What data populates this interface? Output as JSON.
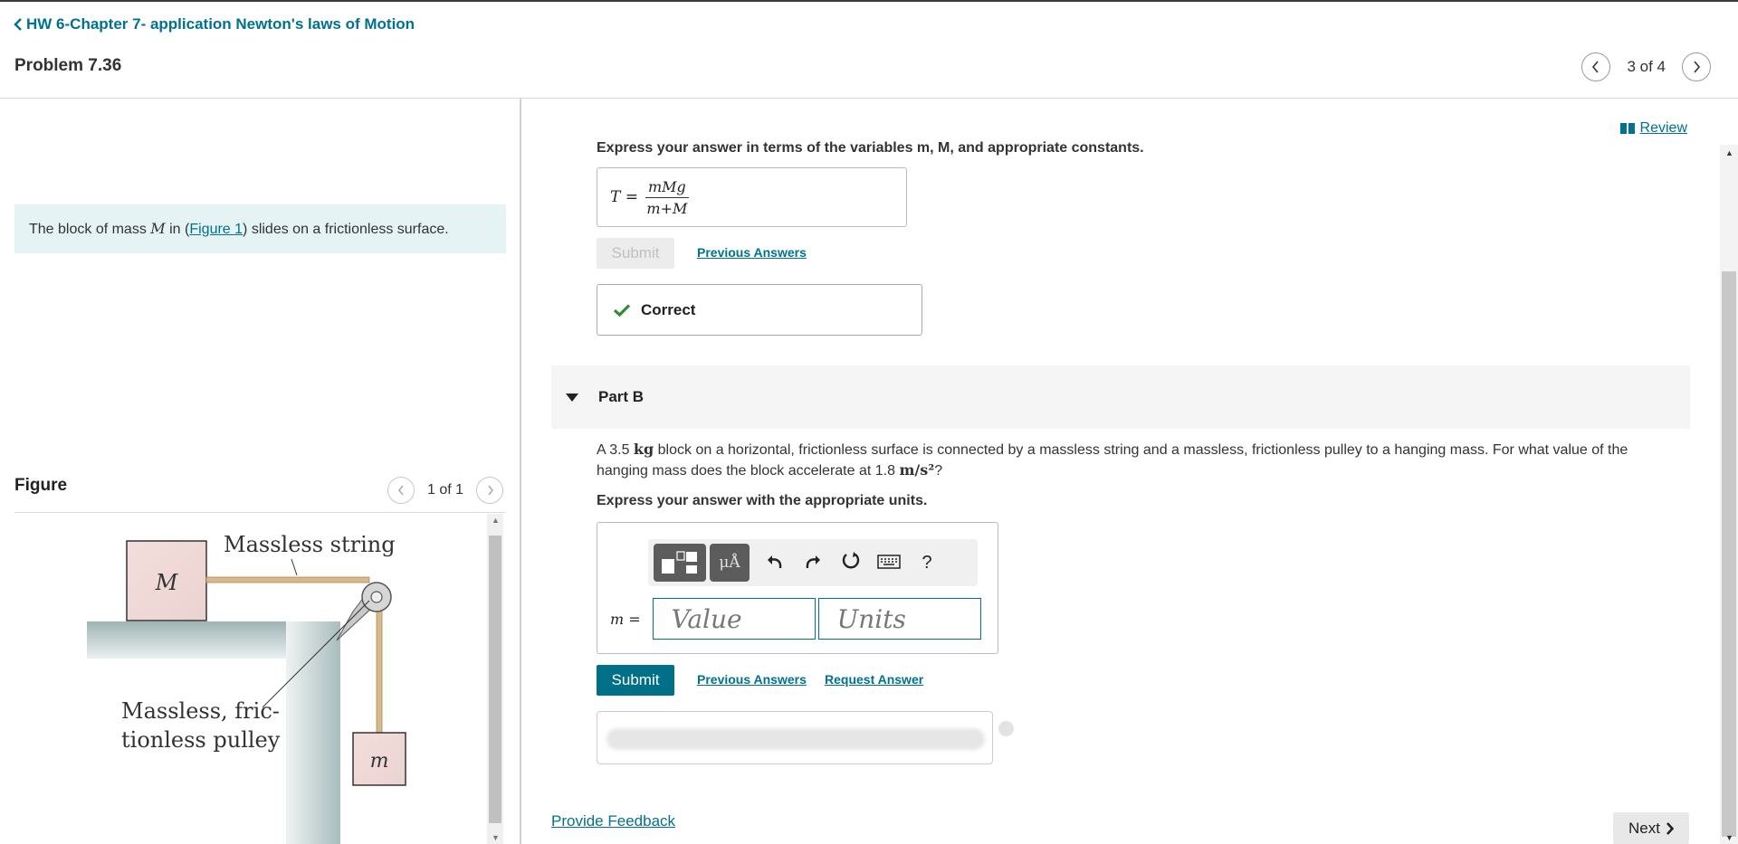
{
  "header": {
    "back_label": "HW 6-Chapter 7- application Newton's laws of Motion",
    "problem_title": "Problem 7.36",
    "pager_text": "3 of 4"
  },
  "intro": {
    "text_before": "The block of mass ",
    "var": "M",
    "text_mid": " in (",
    "link": "Figure 1",
    "text_after": ") slides on a frictionless surface."
  },
  "figure": {
    "heading": "Figure",
    "pager_text": "1 of 1",
    "label_block_M": "M",
    "label_string": "Massless string",
    "label_pulley_line1": "Massless, fric-",
    "label_pulley_line2": "tionless pulley",
    "label_block_m": "m"
  },
  "review": {
    "label": "Review"
  },
  "part_a": {
    "instruction": "Express your answer in terms of the variables m, M, and appropriate constants.",
    "answer_lhs": "T =",
    "answer_num": "mMg",
    "answer_den": "m+M",
    "submit_label": "Submit",
    "previous_answers": "Previous Answers",
    "correct_label": "Correct"
  },
  "part_b": {
    "title": "Part B",
    "problem_pre": "A 3.5 ",
    "unit_kg": "kg",
    "problem_mid": " block on a horizontal, frictionless surface is connected by a massless string and a massless, frictionless pulley to a hanging mass. For what value of the hanging mass does the block accelerate at 1.8 ",
    "unit_accel": "m/s²",
    "problem_post": "?",
    "instruction": "Express your answer with the appropriate units.",
    "toolbar_help": "?",
    "input_label": "m =",
    "value_placeholder": "Value",
    "units_placeholder": "Units",
    "submit_label": "Submit",
    "previous_answers": "Previous Answers",
    "request_answer": "Request Answer"
  },
  "footer": {
    "provide_feedback": "Provide Feedback",
    "next_label": "Next"
  },
  "colors": {
    "accent": "#00718f",
    "submit_bg": "#007089",
    "intro_bg": "#e5f3f4",
    "correct_check": "#2e8b3d"
  }
}
